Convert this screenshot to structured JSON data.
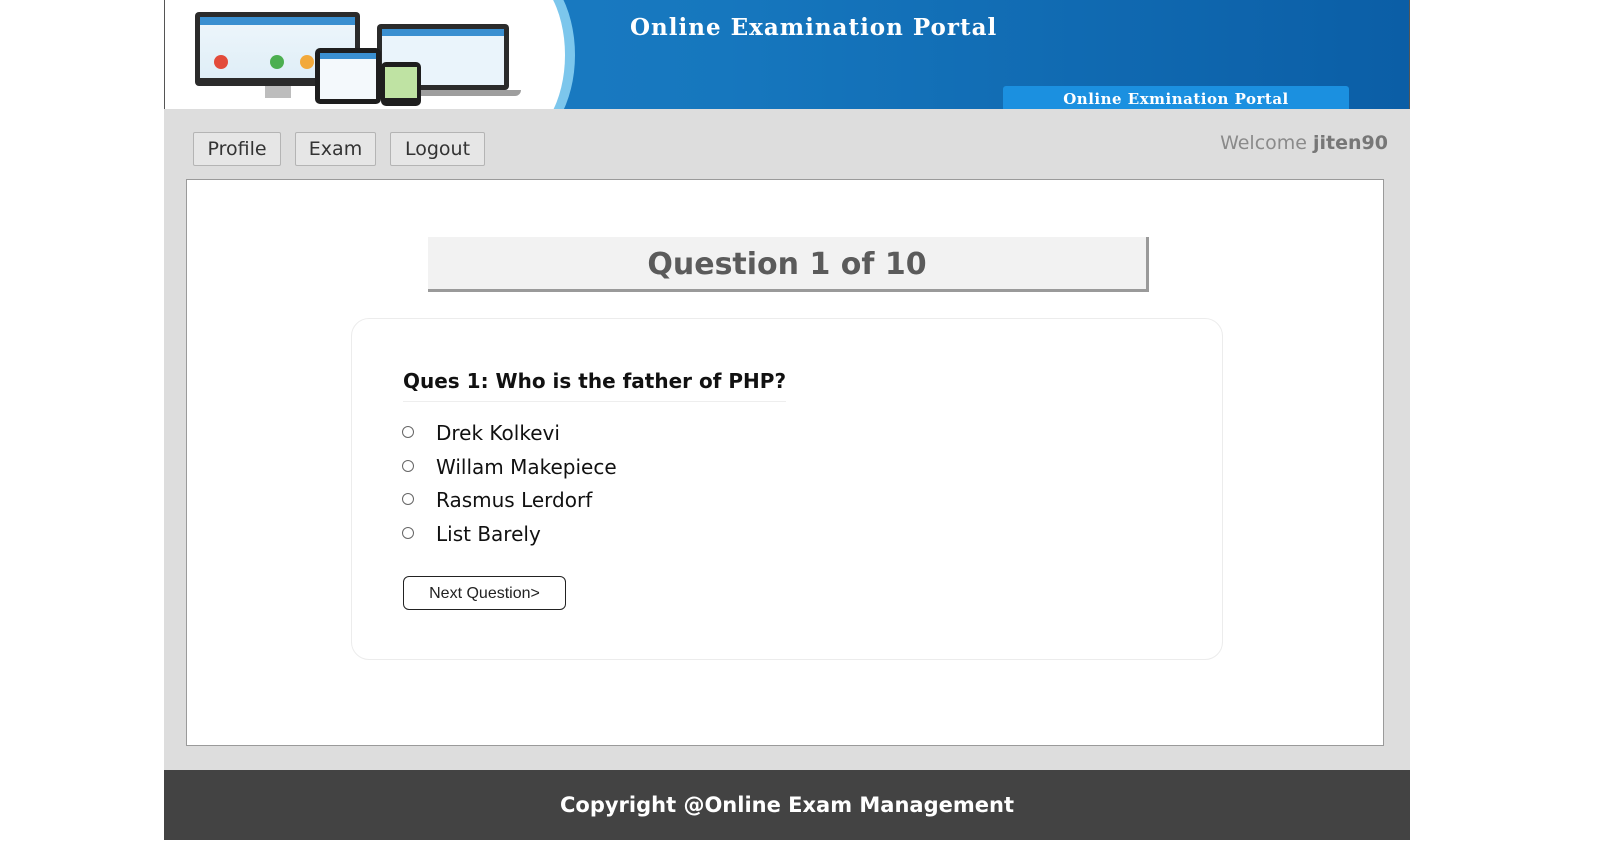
{
  "banner": {
    "title": "Online Examination Portal",
    "tag": "Online Exmination Portal",
    "illustration": "devices-illustration"
  },
  "nav": {
    "items": [
      {
        "label": "Profile"
      },
      {
        "label": "Exam"
      },
      {
        "label": "Logout"
      }
    ],
    "welcome_prefix": "Welcome",
    "username": "jiten90"
  },
  "exam": {
    "progress": "Question 1 of 10",
    "question": "Ques 1: Who is the father of PHP?",
    "options": [
      {
        "label": "Drek Kolkevi",
        "selected": false
      },
      {
        "label": "Willam Makepiece",
        "selected": false
      },
      {
        "label": "Rasmus Lerdorf",
        "selected": false
      },
      {
        "label": "List Barely",
        "selected": false
      }
    ],
    "next_label": "Next Question>"
  },
  "footer": {
    "text": "Copyright @Online Exam Management"
  },
  "colors": {
    "banner_blue": "#1677be",
    "page_gray": "#dddddd",
    "footer_dark": "#434343"
  }
}
